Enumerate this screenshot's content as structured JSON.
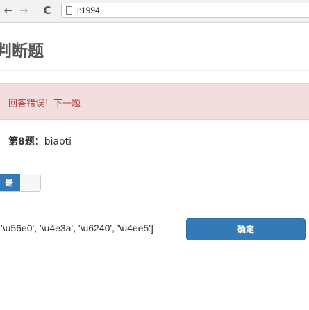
{
  "browser": {
    "back_icon": "←",
    "forward_icon": "→",
    "reload_icon": "C",
    "url": "i:1994"
  },
  "page": {
    "title": "判断题"
  },
  "alert": {
    "message": "回答错误！下一题"
  },
  "question": {
    "prefix": "第8题：",
    "text": "biaoti"
  },
  "toggle": {
    "yes_label": "是",
    "no_label": ""
  },
  "answer": {
    "text": "'\\u56e0', '\\u4e3a', '\\u6240', '\\u4ee5']"
  },
  "confirm_button": {
    "label": "确定"
  },
  "colors": {
    "primary": "#337ab7",
    "alert_bg": "#f2dede",
    "alert_text": "#a94442"
  }
}
